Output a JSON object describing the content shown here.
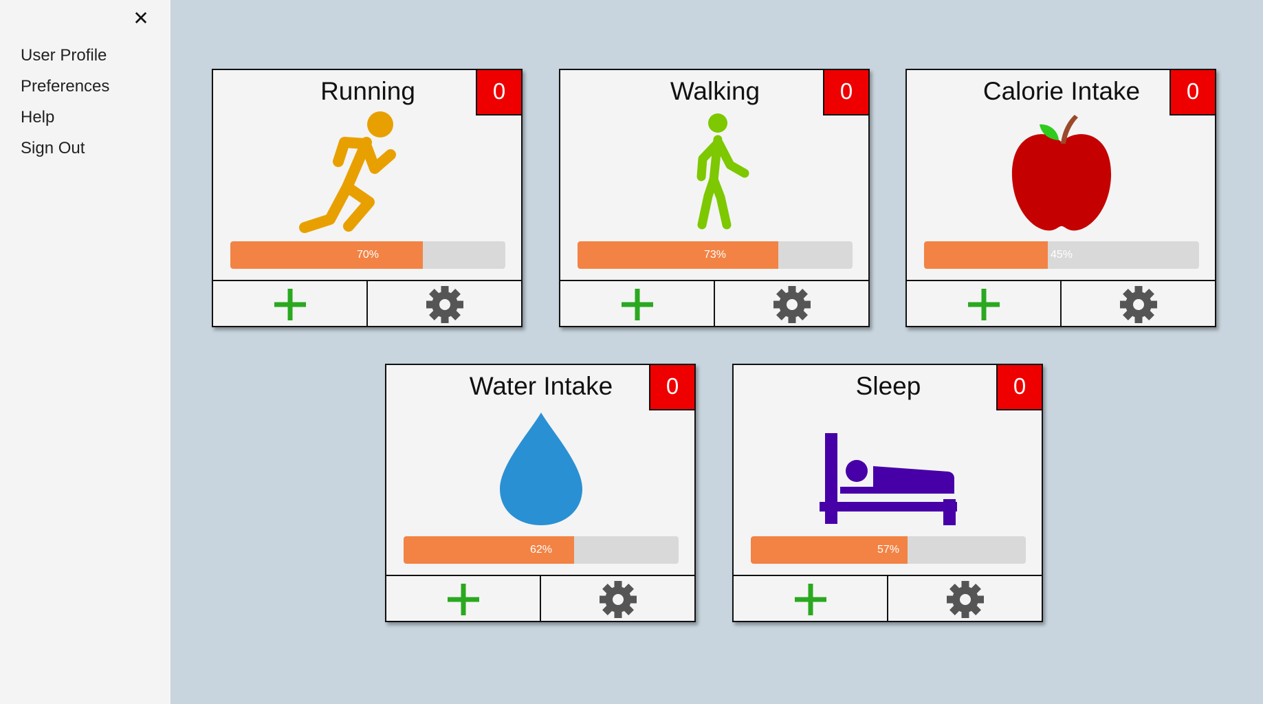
{
  "sidebar": {
    "close_label": "✕",
    "items": [
      {
        "label": "User Profile"
      },
      {
        "label": "Preferences"
      },
      {
        "label": "Help"
      },
      {
        "label": "Sign Out"
      }
    ]
  },
  "cards": [
    {
      "title": "Running",
      "count": "0",
      "progress": 70,
      "progress_label": "70%",
      "icon": "running-person-icon",
      "icon_color": "#e8a000"
    },
    {
      "title": "Walking",
      "count": "0",
      "progress": 73,
      "progress_label": "73%",
      "icon": "walking-person-icon",
      "icon_color": "#7dc800"
    },
    {
      "title": "Calorie Intake",
      "count": "0",
      "progress": 45,
      "progress_label": "45%",
      "icon": "apple-icon",
      "icon_color": "#c40000"
    },
    {
      "title": "Water Intake",
      "count": "0",
      "progress": 62,
      "progress_label": "62%",
      "icon": "water-drop-icon",
      "icon_color": "#2a90d4"
    },
    {
      "title": "Sleep",
      "count": "0",
      "progress": 57,
      "progress_label": "57%",
      "icon": "bed-icon",
      "icon_color": "#4700a8"
    }
  ],
  "colors": {
    "background": "#c8d5de",
    "sidebar": "#f4f4f4",
    "badge": "#ee0000",
    "progress_fill": "#f28344",
    "progress_track": "#d9d9d9",
    "add_icon": "#2aa820",
    "gear_icon": "#555555"
  }
}
